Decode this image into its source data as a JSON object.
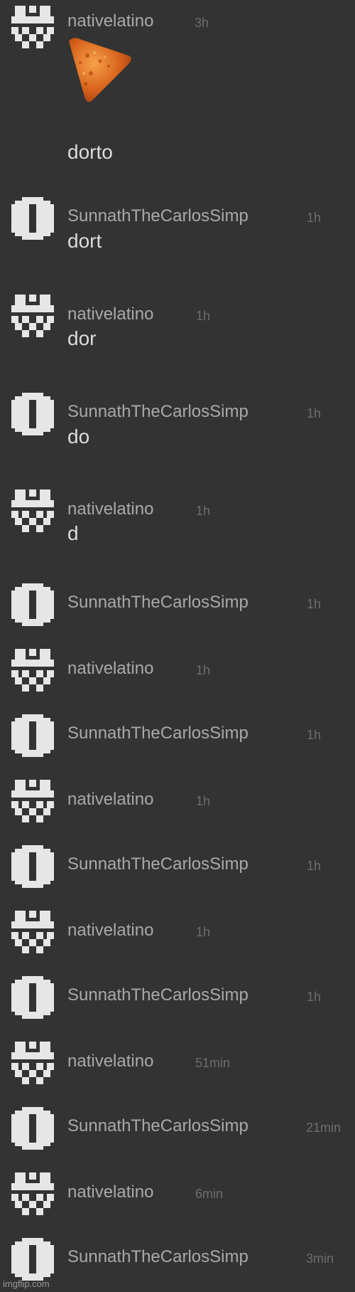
{
  "messages": [
    {
      "user": "nativelatino",
      "time": "3h",
      "sticker": "dorito",
      "text": "dorto"
    },
    {
      "user": "SunnathTheCarlosSimp",
      "time": "1h",
      "text": "dort"
    },
    {
      "user": "nativelatino",
      "time": "1h",
      "text": "dor"
    },
    {
      "user": "SunnathTheCarlosSimp",
      "time": "1h",
      "text": "do"
    },
    {
      "user": "nativelatino",
      "time": "1h",
      "text": "d"
    },
    {
      "user": "SunnathTheCarlosSimp",
      "time": "1h",
      "text": ""
    },
    {
      "user": "nativelatino",
      "time": "1h",
      "text": ""
    },
    {
      "user": "SunnathTheCarlosSimp",
      "time": "1h",
      "text": ""
    },
    {
      "user": "nativelatino",
      "time": "1h",
      "text": ""
    },
    {
      "user": "SunnathTheCarlosSimp",
      "time": "1h",
      "text": ""
    },
    {
      "user": "nativelatino",
      "time": "1h",
      "text": ""
    },
    {
      "user": "SunnathTheCarlosSimp",
      "time": "1h",
      "text": ""
    },
    {
      "user": "nativelatino",
      "time": "51min",
      "text": ""
    },
    {
      "user": "SunnathTheCarlosSimp",
      "time": "21min",
      "text": ""
    },
    {
      "user": "nativelatino",
      "time": "6min",
      "text": ""
    },
    {
      "user": "SunnathTheCarlosSimp",
      "time": "3min",
      "text": ""
    }
  ],
  "colors": {
    "background": "#333333",
    "username": "#a9a9a9",
    "timestamp": "#6d6d6d",
    "message_text": "#dcdcdc",
    "avatar": "#e6e6e6"
  },
  "icons": {
    "nativelatino": "pixel-face-icon",
    "SunnathTheCarlosSimp": "pixel-capsule-icon"
  },
  "watermark": "imgflip.com"
}
